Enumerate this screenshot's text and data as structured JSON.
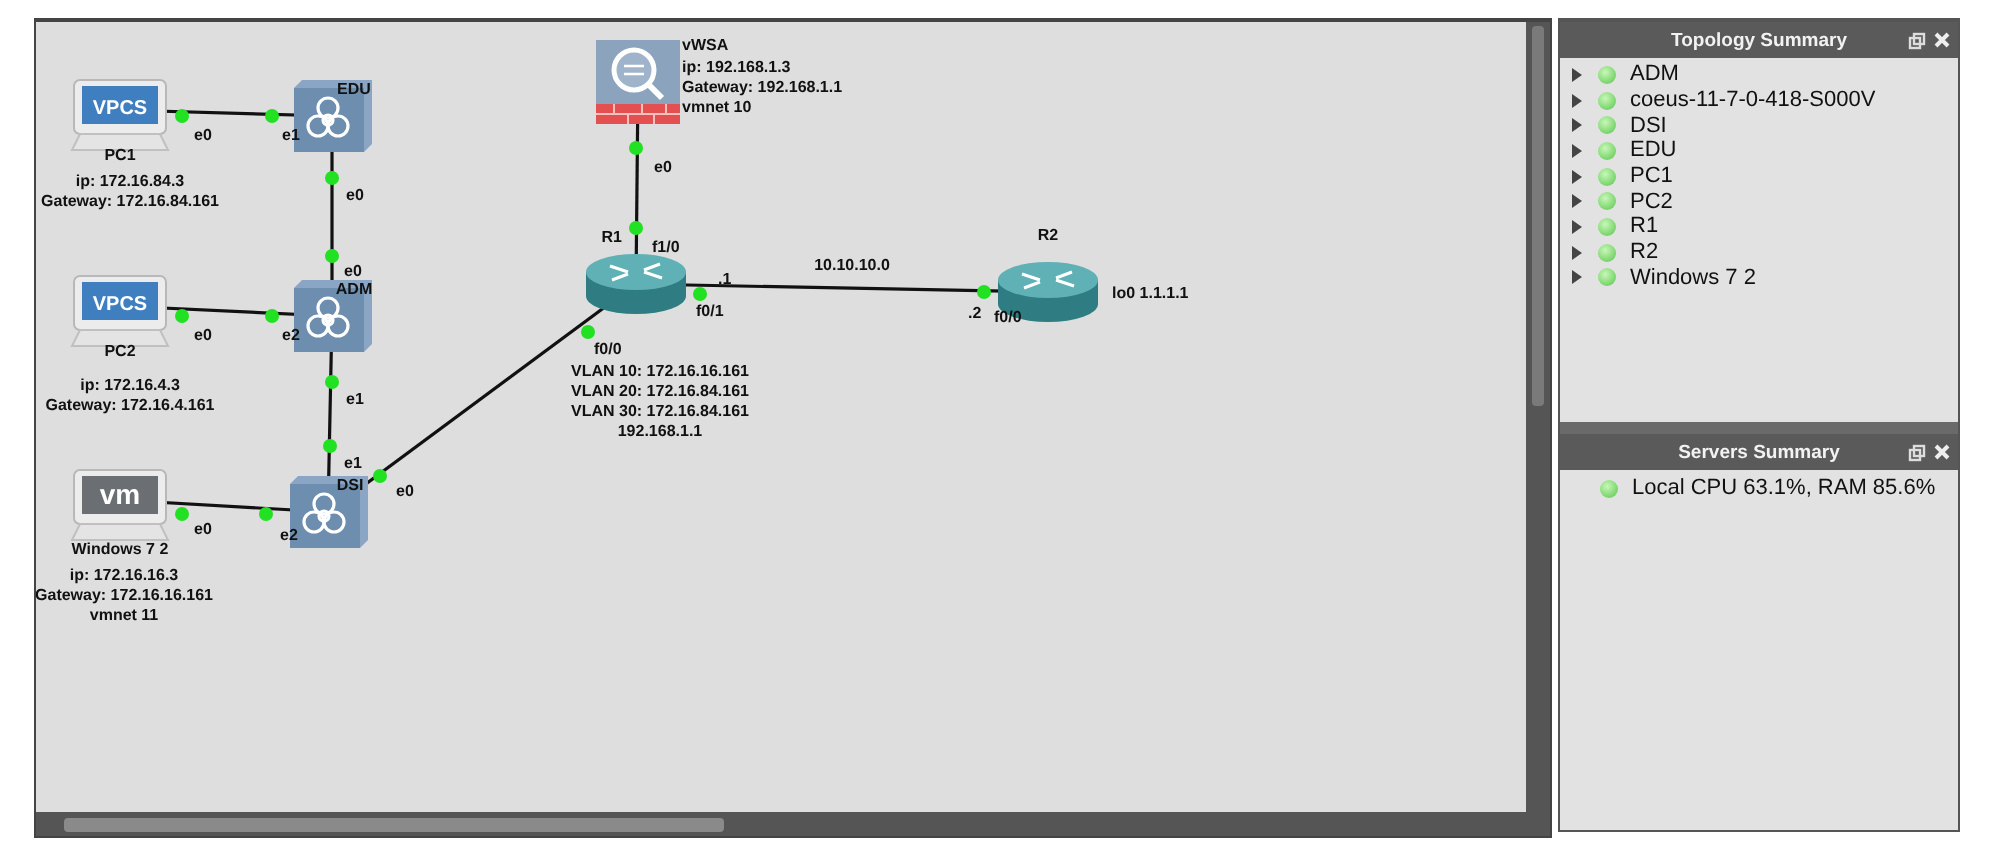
{
  "topology": {
    "nodes": [
      {
        "name": "PC1",
        "kind": "vpcs",
        "screen_text": "VPCS",
        "notes": [
          "ip: 172.16.84.3",
          "Gateway: 172.16.84.161"
        ]
      },
      {
        "name": "EDU",
        "kind": "switch"
      },
      {
        "name": "PC2",
        "kind": "vpcs",
        "screen_text": "VPCS",
        "notes": [
          "ip: 172.16.4.3",
          "Gateway: 172.16.4.161"
        ]
      },
      {
        "name": "ADM",
        "kind": "switch"
      },
      {
        "name": "Windows 7 2",
        "kind": "vm",
        "screen_text": "vm",
        "notes": [
          "ip: 172.16.16.3",
          "Gateway: 172.16.16.161",
          "vmnet 11"
        ]
      },
      {
        "name": "DSI",
        "kind": "switch"
      },
      {
        "name": "vWSA",
        "kind": "firewall",
        "notes": [
          "ip: 192.168.1.3",
          "Gateway: 192.168.1.1",
          "vmnet 10"
        ]
      },
      {
        "name": "R1",
        "kind": "router",
        "notes": [
          "VLAN 10:  172.16.16.161",
          "VLAN 20:  172.16.84.161",
          "VLAN 30:  172.16.84.161",
          "192.168.1.1"
        ]
      },
      {
        "name": "R2",
        "kind": "router",
        "notes": [
          "lo0 1.1.1.1"
        ]
      }
    ],
    "links": [
      {
        "a_port": "e0",
        "b_port": "e1"
      },
      {
        "a_port": "e0",
        "b_port": "e0"
      },
      {
        "a_port": "e0",
        "b_port": "e2"
      },
      {
        "a_port": "e1",
        "b_port": "e1"
      },
      {
        "a_port": "e0",
        "b_port": "e2"
      },
      {
        "a_port": "e0",
        "b_port": "f0/0"
      },
      {
        "a_port": "e0",
        "b_port": "f1/0"
      },
      {
        "a_port": "f0/1",
        "b_port": "f0/0",
        "a_addr": ".1",
        "b_addr": ".2",
        "label": "10.10.10.0"
      }
    ]
  },
  "topology_summary": {
    "title": "Topology Summary",
    "items": [
      {
        "name": "ADM",
        "expanded": false
      },
      {
        "name": "coeus-11-7-0-418-S000V",
        "expanded": false
      },
      {
        "name": "DSI",
        "expanded": false
      },
      {
        "name": "EDU",
        "expanded": false
      },
      {
        "name": "PC1",
        "expanded": false
      },
      {
        "name": "PC2",
        "expanded": false
      },
      {
        "name": "R1",
        "expanded": false
      },
      {
        "name": "R2",
        "expanded": false
      },
      {
        "name": "Windows 7 2",
        "expanded": false
      }
    ]
  },
  "servers_summary": {
    "title": "Servers Summary",
    "items": [
      "Local CPU 63.1%, RAM 85.6%"
    ]
  }
}
